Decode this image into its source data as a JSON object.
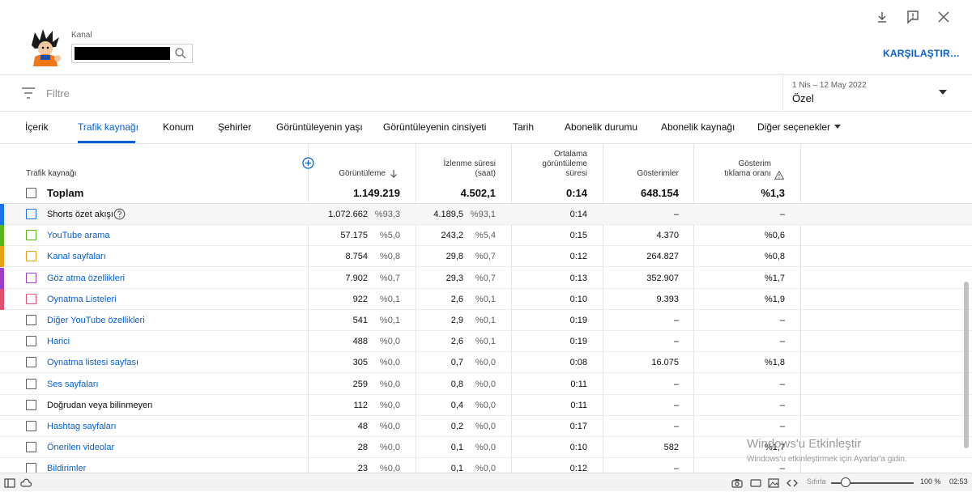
{
  "header": {
    "channel_label": "Kanal",
    "compare_label": "KARŞILAŞTIR…",
    "icons": [
      "download-icon",
      "feedback-icon",
      "close-icon"
    ]
  },
  "filter": {
    "placeholder": "Filtre",
    "date_range": "1 Nis – 12 May 2022",
    "date_mode": "Özel"
  },
  "tabs": [
    {
      "label": "İçerik"
    },
    {
      "label": "Trafik kaynağı",
      "active": true
    },
    {
      "label": "Konum"
    },
    {
      "label": "Şehirler"
    },
    {
      "label": "Görüntüleyenin yaşı"
    },
    {
      "label": "Görüntüleyenin cinsiyeti"
    },
    {
      "label": "Tarih"
    },
    {
      "label": "Abonelik durumu"
    },
    {
      "label": "Abonelik kaynağı"
    },
    {
      "label": "Diğer seçenekler"
    }
  ],
  "table": {
    "columns": {
      "source": "Trafik kaynağı",
      "views": "Görüntüleme",
      "watch_l1": "İzlenme süresi",
      "watch_l2": "(saat)",
      "avg_l1": "Ortalama",
      "avg_l2": "görüntüleme",
      "avg_l3": "süresi",
      "impr": "Gösterimler",
      "ctr_l1": "Gösterim",
      "ctr_l2": "tıklama oranı"
    },
    "total": {
      "name": "Toplam",
      "views": "1.149.219",
      "watch": "4.502,1",
      "avg": "0:14",
      "impr": "648.154",
      "ctr": "%1,3"
    },
    "rows": [
      {
        "name": "Shorts özet akışı",
        "views": "1.072.662",
        "views_pct": "%93,3",
        "watch": "4.189,5",
        "watch_pct": "%93,1",
        "avg": "0:14",
        "impr": "–",
        "ctr": "–",
        "color": "#1a73e8",
        "plain": true,
        "help": true
      },
      {
        "name": "YouTube arama",
        "views": "57.175",
        "views_pct": "%5,0",
        "watch": "243,2",
        "watch_pct": "%5,4",
        "avg": "0:15",
        "impr": "4.370",
        "ctr": "%0,6",
        "color": "#5bb318"
      },
      {
        "name": "Kanal sayfaları",
        "views": "8.754",
        "views_pct": "%0,8",
        "watch": "29,8",
        "watch_pct": "%0,7",
        "avg": "0:12",
        "impr": "264.827",
        "ctr": "%0,8",
        "color": "#e8a21a"
      },
      {
        "name": "Göz atma özellikleri",
        "views": "7.902",
        "views_pct": "%0,7",
        "watch": "29,3",
        "watch_pct": "%0,7",
        "avg": "0:13",
        "impr": "352.907",
        "ctr": "%1,7",
        "color": "#9c3fc8"
      },
      {
        "name": "Oynatma Listeleri",
        "views": "922",
        "views_pct": "%0,1",
        "watch": "2,6",
        "watch_pct": "%0,1",
        "avg": "0:10",
        "impr": "9.393",
        "ctr": "%1,9",
        "color": "#e0506f"
      },
      {
        "name": "Diğer YouTube özellikleri",
        "views": "541",
        "views_pct": "%0,1",
        "watch": "2,9",
        "watch_pct": "%0,1",
        "avg": "0:19",
        "impr": "–",
        "ctr": "–",
        "color": ""
      },
      {
        "name": "Harici",
        "views": "488",
        "views_pct": "%0,0",
        "watch": "2,6",
        "watch_pct": "%0,1",
        "avg": "0:19",
        "impr": "–",
        "ctr": "–",
        "color": ""
      },
      {
        "name": "Oynatma listesi sayfası",
        "views": "305",
        "views_pct": "%0,0",
        "watch": "0,7",
        "watch_pct": "%0,0",
        "avg": "0:08",
        "impr": "16.075",
        "ctr": "%1,8",
        "color": ""
      },
      {
        "name": "Ses sayfaları",
        "views": "259",
        "views_pct": "%0,0",
        "watch": "0,8",
        "watch_pct": "%0,0",
        "avg": "0:11",
        "impr": "–",
        "ctr": "–",
        "color": ""
      },
      {
        "name": "Doğrudan veya bilinmeyen",
        "views": "112",
        "views_pct": "%0,0",
        "watch": "0,4",
        "watch_pct": "%0,0",
        "avg": "0:11",
        "impr": "–",
        "ctr": "–",
        "color": "",
        "plain": true
      },
      {
        "name": "Hashtag sayfaları",
        "views": "48",
        "views_pct": "%0,0",
        "watch": "0,2",
        "watch_pct": "%0,0",
        "avg": "0:17",
        "impr": "–",
        "ctr": "–",
        "color": ""
      },
      {
        "name": "Önerilen videolar",
        "views": "28",
        "views_pct": "%0,0",
        "watch": "0,1",
        "watch_pct": "%0,0",
        "avg": "0:10",
        "impr": "582",
        "ctr": "%1,7",
        "color": ""
      },
      {
        "name": "Bildirimler",
        "views": "23",
        "views_pct": "%0,0",
        "watch": "0,1",
        "watch_pct": "%0,0",
        "avg": "0:12",
        "impr": "–",
        "ctr": "–",
        "color": ""
      }
    ]
  },
  "watermark": {
    "line1": "Windows'u Etkinleştir",
    "line2": "Windows'u etkinleştirmek için Ayarlar'a gidin."
  },
  "taskbar": {
    "reset_label": "Sıfırla",
    "zoom": "100 %",
    "time": "02:53"
  }
}
